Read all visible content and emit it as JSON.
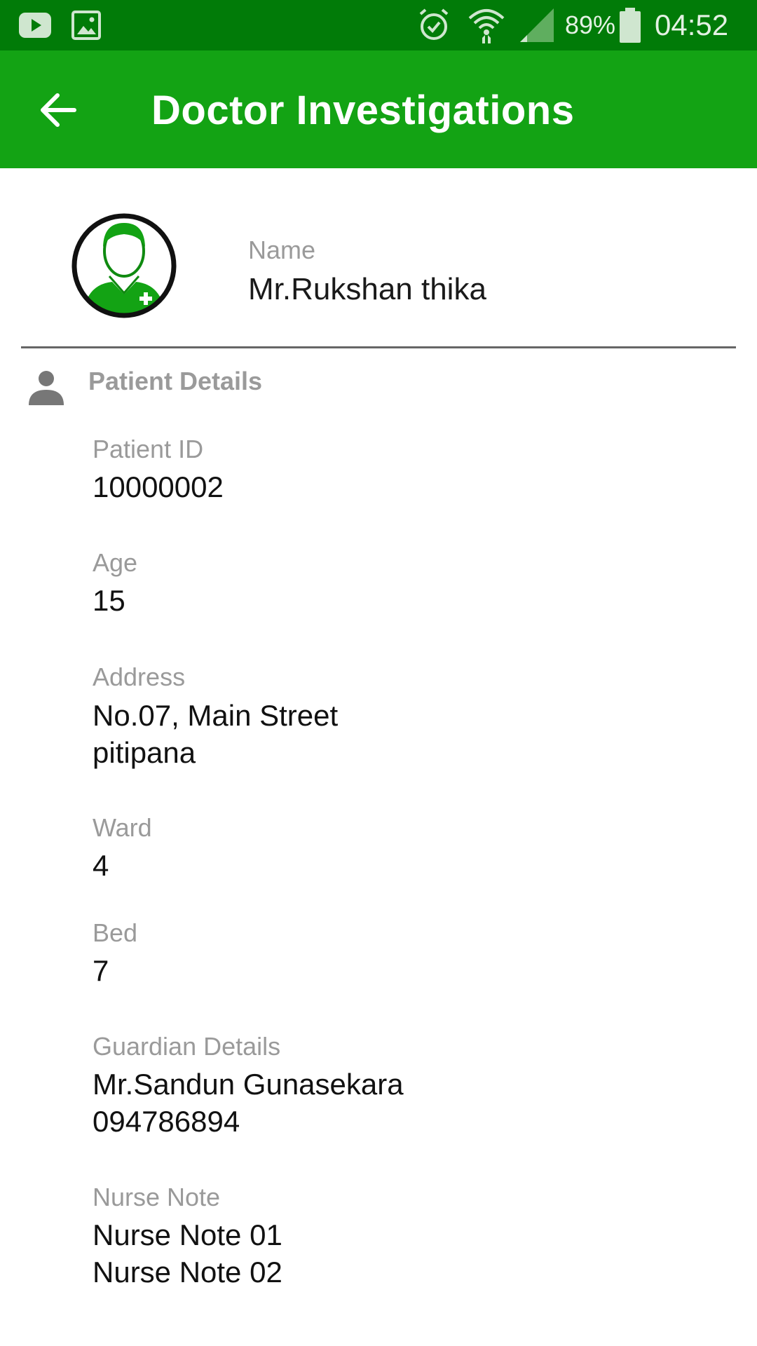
{
  "status_bar": {
    "battery_percent": "89%",
    "time": "04:52",
    "icons": [
      "youtube-icon",
      "gallery-icon",
      "alarm-icon",
      "wifi-icon",
      "signal-icon",
      "battery-icon"
    ]
  },
  "toolbar": {
    "title": "Doctor Investigations",
    "back_icon": "arrow-back-icon",
    "color": "#13a314"
  },
  "profile": {
    "name_label": "Name",
    "name_value": "Mr.Rukshan thika",
    "avatar_icon": "doctor-avatar-icon"
  },
  "section": {
    "title": "Patient Details",
    "icon": "person-icon"
  },
  "fields": {
    "patient_id": {
      "label": "Patient ID",
      "value": "10000002"
    },
    "age": {
      "label": "Age",
      "value": "15"
    },
    "address": {
      "label": "Address",
      "lines": [
        "No.07, Main Street",
        "pitipana"
      ]
    },
    "ward": {
      "label": "Ward",
      "value": "4"
    },
    "bed": {
      "label": "Bed",
      "value": "7"
    },
    "guardian": {
      "label": "Guardian Details",
      "lines": [
        "Mr.Sandun Gunasekara",
        "094786894"
      ]
    },
    "nurse_note": {
      "label": "Nurse Note",
      "lines": [
        "Nurse Note 01",
        "Nurse Note 02"
      ]
    }
  }
}
